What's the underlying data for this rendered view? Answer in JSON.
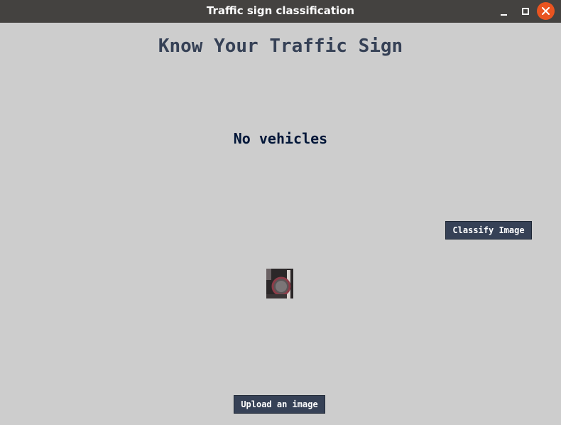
{
  "window": {
    "title": "Traffic sign classification"
  },
  "heading": "Know Your Traffic Sign",
  "result_text": "No vehicles",
  "buttons": {
    "classify": "Classify Image",
    "upload": "Upload an image"
  },
  "icons": {
    "minimize": "minimize-icon",
    "maximize": "maximize-icon",
    "close": "close-icon"
  },
  "colors": {
    "background": "#cdcdcd",
    "titlebar": "#444240",
    "close_button": "#e95420",
    "heading": "#364156",
    "result": "#011638",
    "button_bg": "#364156"
  }
}
